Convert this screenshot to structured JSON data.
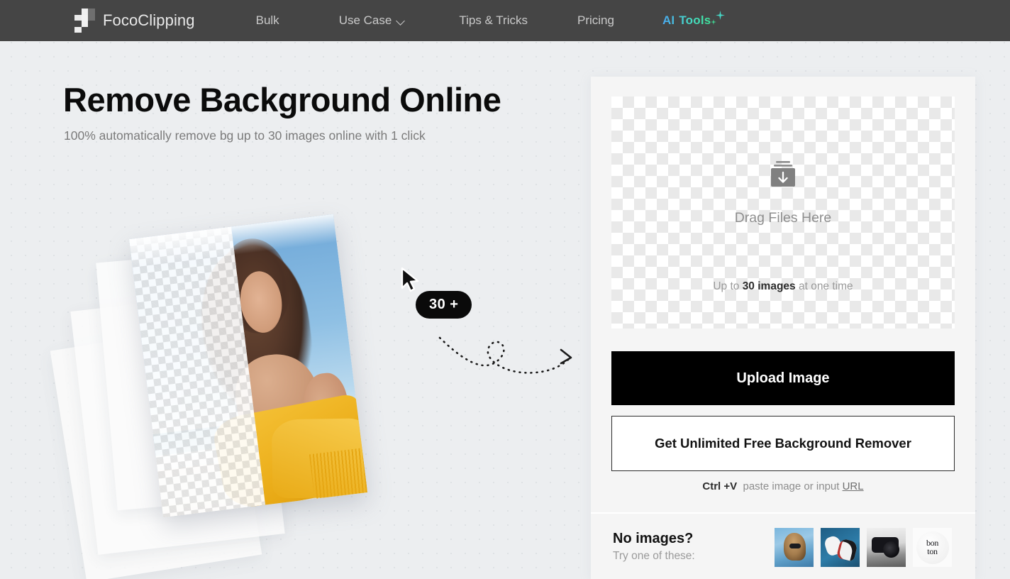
{
  "header": {
    "brand_name": "FocoClipping",
    "logo_icon": "checker-squares-logo",
    "nav": [
      {
        "label": "Bulk",
        "icon": null
      },
      {
        "label": "Use Case",
        "icon": "chevron-down-icon"
      },
      {
        "label": "Tips & Tricks",
        "icon": null
      },
      {
        "label": "Pricing",
        "icon": null
      }
    ],
    "ai_tools": {
      "label_a": "AI",
      "label_b": "Tools",
      "icon": "sparkle-icon",
      "gradient_from": "#4aa8f0",
      "gradient_to": "#3fe39a"
    },
    "background_color": "#454545"
  },
  "hero": {
    "title": "Remove Background Online",
    "subtitle": "100% automatically remove bg up to 30 images online with 1 click",
    "badge": "30 +",
    "cursor_icon": "mouse-pointer-icon",
    "arrow_icon": "dotted-curved-arrow-icon",
    "artwork_alt": "woman-on-beach-photo-with-transparent-checkerboard-overlay"
  },
  "panel": {
    "dropzone": {
      "icon": "tray-download-icon",
      "drag_text": "Drag Files Here",
      "limit_prefix": "Up to ",
      "limit_bold": "30 images",
      "limit_suffix": " at one time"
    },
    "upload_button": "Upload Image",
    "unlimited_button": "Get Unlimited Free Background Remover",
    "paste_hint": {
      "shortcut": "Ctrl +V",
      "text": "paste image or input",
      "link": "URL"
    },
    "samples": {
      "title": "No images?",
      "subtitle": "Try one of these:",
      "thumbnails": [
        {
          "name": "sample-woman-sunglasses"
        },
        {
          "name": "sample-white-sneakers"
        },
        {
          "name": "sample-camera"
        },
        {
          "name": "sample-bon-ton-logo"
        }
      ]
    },
    "background_color": "#f5f5f5"
  }
}
